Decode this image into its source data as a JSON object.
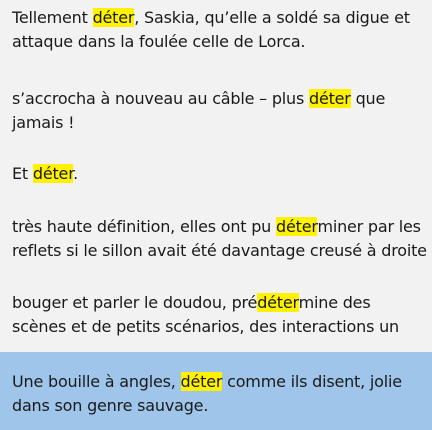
{
  "colors": {
    "background": "#f2f2f2",
    "highlight": "#fff200",
    "selected_background": "#9fc6ea",
    "text": "#1a1a1a"
  },
  "results": [
    {
      "lines": [
        {
          "before": "Tellement ",
          "match": "déter",
          "after": ", Saskia, qu’elle a soldé sa digue et"
        },
        {
          "before": "attaque dans la foulée celle de Lorca.",
          "match": "",
          "after": ""
        }
      ],
      "selected": false
    },
    {
      "lines": [
        {
          "before": " s’accrocha à nouveau au câble – plus ",
          "match": "déter",
          "after": " que"
        },
        {
          "before": "jamais !",
          "match": "",
          "after": ""
        }
      ],
      "selected": false
    },
    {
      "lines": [
        {
          "before": "Et ",
          "match": "déter",
          "after": "."
        }
      ],
      "selected": false
    },
    {
      "lines": [
        {
          "before": " très haute définition, elles ont pu ",
          "match": "déter",
          "after": "miner par les"
        },
        {
          "before": "reflets si le sillon avait été davantage creusé à droite",
          "match": "",
          "after": ""
        }
      ],
      "selected": false
    },
    {
      "lines": [
        {
          "before": " bouger et parler le doudou, pré",
          "match": "déter",
          "after": "mine des"
        },
        {
          "before": "scènes et de petits scénarios, des interactions un",
          "match": "",
          "after": ""
        }
      ],
      "selected": false
    },
    {
      "lines": [
        {
          "before": "Une bouille à angles, ",
          "match": "déter",
          "after": " comme ils disent, jolie"
        },
        {
          "before": "dans son genre sauvage.",
          "match": "",
          "after": ""
        }
      ],
      "selected": true
    }
  ]
}
